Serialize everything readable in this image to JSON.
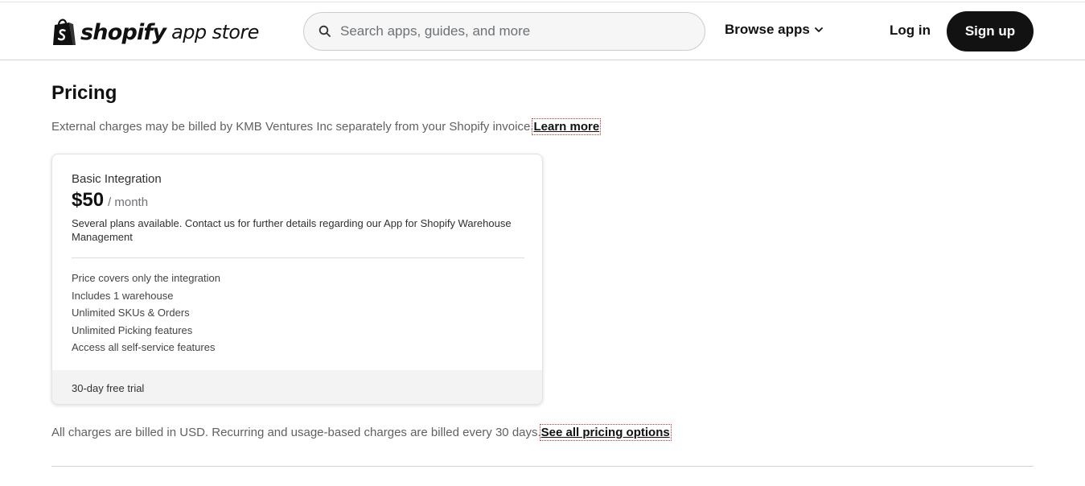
{
  "header": {
    "logo_wordmark": "shopify",
    "logo_suffix": "app store",
    "search": {
      "placeholder": "Search apps, guides, and more",
      "value": ""
    },
    "browse_label": "Browse apps",
    "login_label": "Log in",
    "signup_label": "Sign up"
  },
  "pricing": {
    "title": "Pricing",
    "external_note": "External charges may be billed by KMB Ventures Inc separately from your Shopify invoice.",
    "learn_more": "Learn more",
    "plan": {
      "name": "Basic Integration",
      "price": "$50",
      "period": "/ month",
      "description": "Several plans available. Contact us for further details regarding our App for Shopify Warehouse Management",
      "features": [
        "Price covers only the integration",
        "Includes 1 warehouse",
        "Unlimited SKUs & Orders",
        "Unlimited Picking features",
        "Access all self-service features"
      ],
      "trial": "30-day free trial"
    },
    "billing_note": "All charges are billed in USD. Recurring and usage-based charges are billed every 30 days.",
    "see_all": "See all pricing options"
  },
  "icons": {
    "logo": "shopify-bag-icon",
    "search": "search-icon",
    "browse": "chevron-down-icon"
  },
  "colors": {
    "signup_bg": "#121212",
    "text": "#202223",
    "muted": "#616161",
    "card_footer": "#f3f3f3"
  }
}
